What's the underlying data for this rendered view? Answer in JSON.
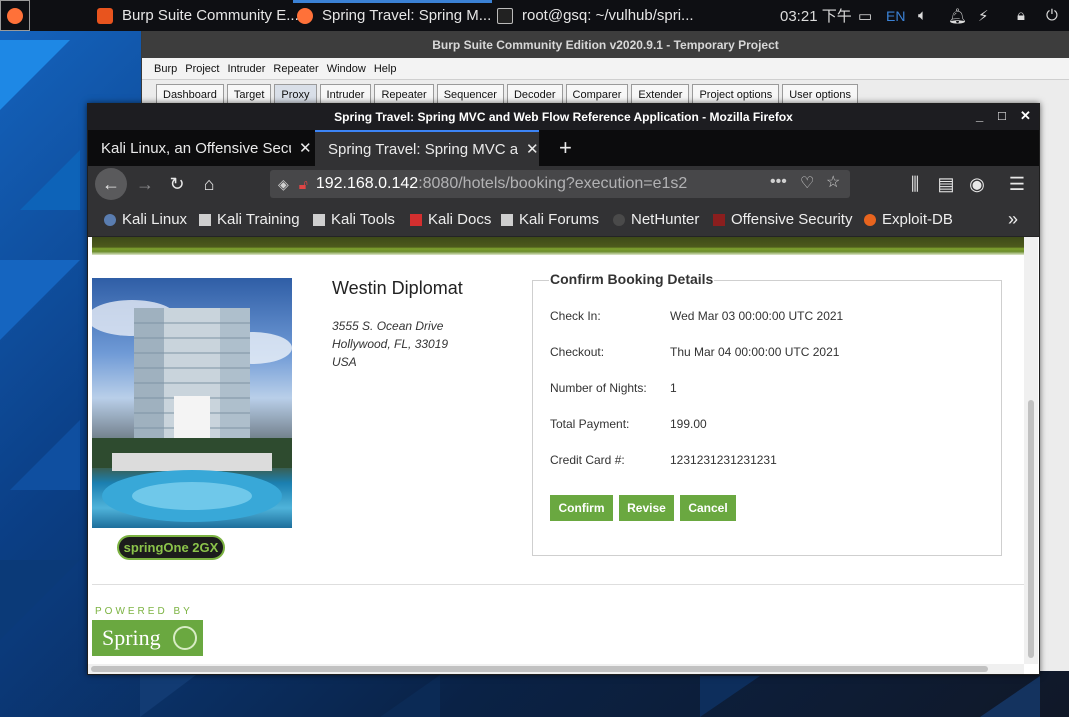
{
  "taskbar": {
    "items": [
      {
        "label": "Burp Suite Community E...",
        "color": "#e8541e"
      },
      {
        "label": "Spring Travel: Spring M...",
        "color": "#ff7139"
      },
      {
        "label": "root@gsq: ~/vulhub/spri...",
        "color": "#444444"
      }
    ],
    "clock": "03:21 下午",
    "lang": "EN"
  },
  "burp": {
    "title": "Burp Suite Community Edition v2020.9.1 - Temporary Project",
    "menu": [
      "Burp",
      "Project",
      "Intruder",
      "Repeater",
      "Window",
      "Help"
    ],
    "tabs": [
      "Dashboard",
      "Target",
      "Proxy",
      "Intruder",
      "Repeater",
      "Sequencer",
      "Decoder",
      "Comparer",
      "Extender",
      "Project options",
      "User options"
    ]
  },
  "firefox": {
    "title": "Spring Travel: Spring MVC and Web Flow Reference Application - Mozilla Firefox",
    "tabs": [
      {
        "label": "Kali Linux, an Offensive Security"
      },
      {
        "label": "Spring Travel: Spring MVC and Web Flow"
      }
    ],
    "url": {
      "host": "192.168.0.142",
      "rest": ":8080/hotels/booking?execution=e1s2"
    },
    "bookmarks": [
      "Kali Linux",
      "Kali Training",
      "Kali Tools",
      "Kali Docs",
      "Kali Forums",
      "NetHunter",
      "Offensive Security",
      "Exploit-DB"
    ]
  },
  "page": {
    "hotel": {
      "name": "Westin Diplomat",
      "address1": "3555 S. Ocean Drive",
      "address2": "Hollywood, FL, 33019",
      "country": "USA"
    },
    "badge": "springOne 2GX",
    "booking": {
      "legend": "Confirm Booking Details",
      "rows": [
        {
          "label": "Check In:",
          "value": "Wed Mar 03 00:00:00 UTC 2021"
        },
        {
          "label": "Checkout:",
          "value": "Thu Mar 04 00:00:00 UTC 2021"
        },
        {
          "label": "Number of Nights:",
          "value": "1"
        },
        {
          "label": "Total Payment:",
          "value": "199.00"
        },
        {
          "label": "Credit Card #:",
          "value": "1231231231231231"
        }
      ],
      "buttons": {
        "confirm": "Confirm",
        "revise": "Revise",
        "cancel": "Cancel"
      }
    },
    "footer": {
      "powered": "POWERED BY",
      "logo": "Spring"
    }
  }
}
